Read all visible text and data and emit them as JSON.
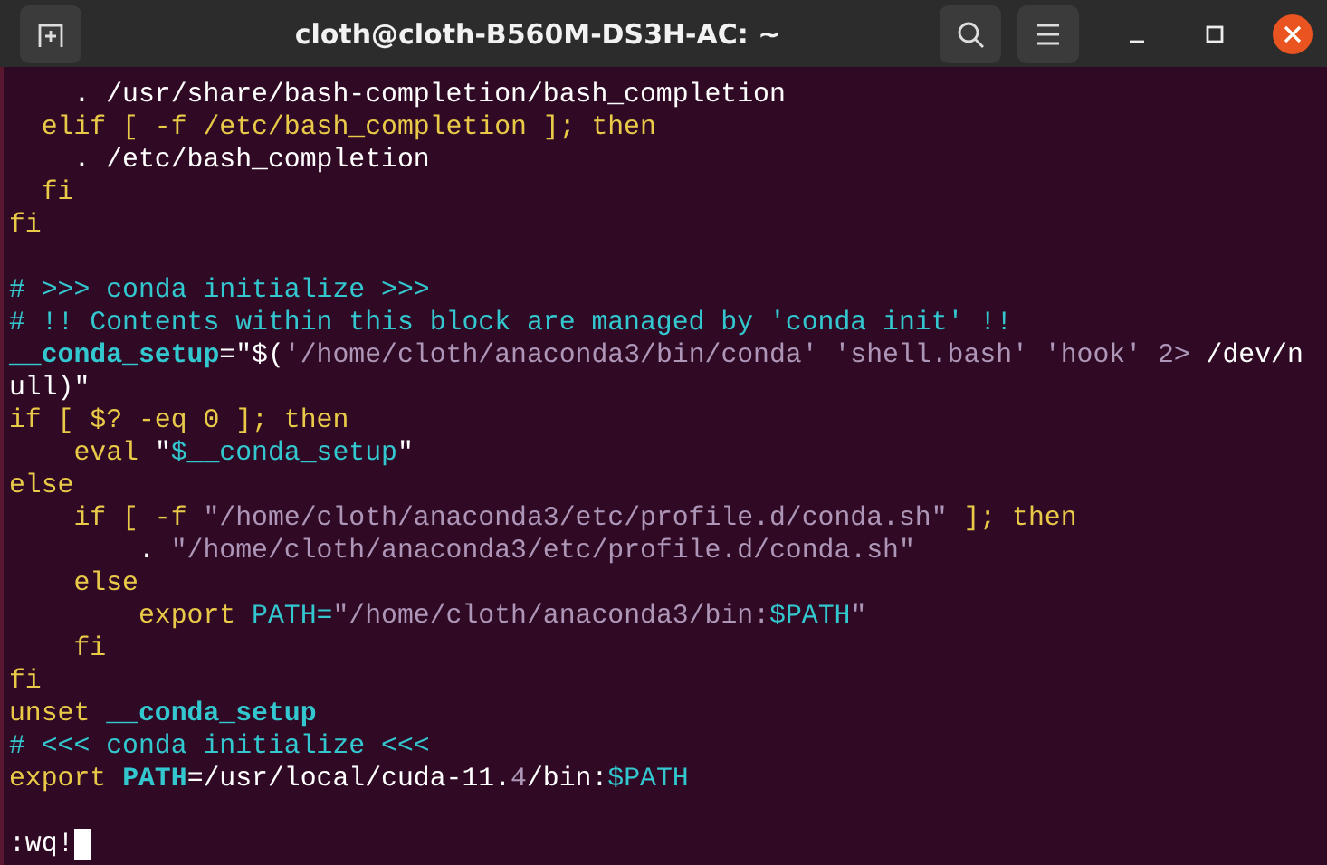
{
  "window": {
    "title": "cloth@cloth-B560M-DS3H-AC: ~"
  },
  "editor": {
    "blocks": [
      {
        "lines": [
          {
            "segments": [
              {
                "text": "    . /usr/share/bash-completion/bash_completion",
                "kind": "plain"
              }
            ]
          },
          {
            "segments": [
              {
                "text": "  elif [ -f /etc/bash_completion ]; then",
                "kind": "keyword"
              }
            ]
          },
          {
            "segments": [
              {
                "text": "    . /etc/bash_completion",
                "kind": "plain"
              }
            ]
          },
          {
            "segments": [
              {
                "text": "  fi",
                "kind": "keyword"
              }
            ]
          },
          {
            "segments": [
              {
                "text": "fi",
                "kind": "keyword"
              }
            ]
          }
        ]
      },
      {
        "lines": [
          {
            "segments": [
              {
                "text": "# >>> conda initialize >>>",
                "kind": "comment"
              }
            ]
          },
          {
            "segments": [
              {
                "text": "# !! Contents within this block are managed by 'conda init' !!",
                "kind": "comment"
              }
            ]
          },
          {
            "segments": [
              {
                "text": "__conda_setup",
                "kind": "ident"
              },
              {
                "text": "=\"$(",
                "kind": "plain"
              },
              {
                "text": "'/home/cloth/anaconda3/bin/conda' 'shell.bash' 'hook' 2>",
                "kind": "string"
              },
              {
                "text": " /dev/n",
                "kind": "plain"
              }
            ]
          },
          {
            "segments": [
              {
                "text": "ull)\"",
                "kind": "plain"
              }
            ]
          },
          {
            "segments": [
              {
                "text": "if [ $? -eq 0 ]; then",
                "kind": "keyword"
              }
            ]
          },
          {
            "segments": [
              {
                "text": "    eval ",
                "kind": "keyword"
              },
              {
                "text": "\"",
                "kind": "plain"
              },
              {
                "text": "$__conda_setup",
                "kind": "variable"
              },
              {
                "text": "\"",
                "kind": "plain"
              }
            ]
          },
          {
            "segments": [
              {
                "text": "else",
                "kind": "keyword"
              }
            ]
          },
          {
            "segments": [
              {
                "text": "    if [ -f ",
                "kind": "keyword"
              },
              {
                "text": "\"/home/cloth/anaconda3/etc/profile.d/conda.sh\"",
                "kind": "string"
              },
              {
                "text": " ]; then",
                "kind": "keyword"
              }
            ]
          },
          {
            "segments": [
              {
                "text": "        . ",
                "kind": "plain"
              },
              {
                "text": "\"/home/cloth/anaconda3/etc/profile.d/conda.sh\"",
                "kind": "string"
              }
            ]
          },
          {
            "segments": [
              {
                "text": "    else",
                "kind": "keyword"
              }
            ]
          },
          {
            "segments": [
              {
                "text": "        export ",
                "kind": "keyword"
              },
              {
                "text": "PATH=",
                "kind": "variable"
              },
              {
                "text": "\"/home/cloth/anaconda3/bin:",
                "kind": "string"
              },
              {
                "text": "$PATH",
                "kind": "variable"
              },
              {
                "text": "\"",
                "kind": "string"
              }
            ]
          },
          {
            "segments": [
              {
                "text": "    fi",
                "kind": "keyword"
              }
            ]
          },
          {
            "segments": [
              {
                "text": "fi",
                "kind": "keyword"
              }
            ]
          },
          {
            "segments": [
              {
                "text": "unset ",
                "kind": "keyword"
              },
              {
                "text": "__conda_setup",
                "kind": "ident"
              }
            ]
          },
          {
            "segments": [
              {
                "text": "# <<< conda initialize <<<",
                "kind": "comment"
              }
            ]
          },
          {
            "segments": [
              {
                "text": "export ",
                "kind": "keyword"
              },
              {
                "text": "PATH",
                "kind": "ident"
              },
              {
                "text": "=/usr/local/cuda-11.",
                "kind": "plain"
              },
              {
                "text": "4",
                "kind": "string"
              },
              {
                "text": "/bin:",
                "kind": "plain"
              },
              {
                "text": "$PATH",
                "kind": "variable"
              }
            ]
          }
        ]
      }
    ],
    "command_line": ":wq!"
  }
}
